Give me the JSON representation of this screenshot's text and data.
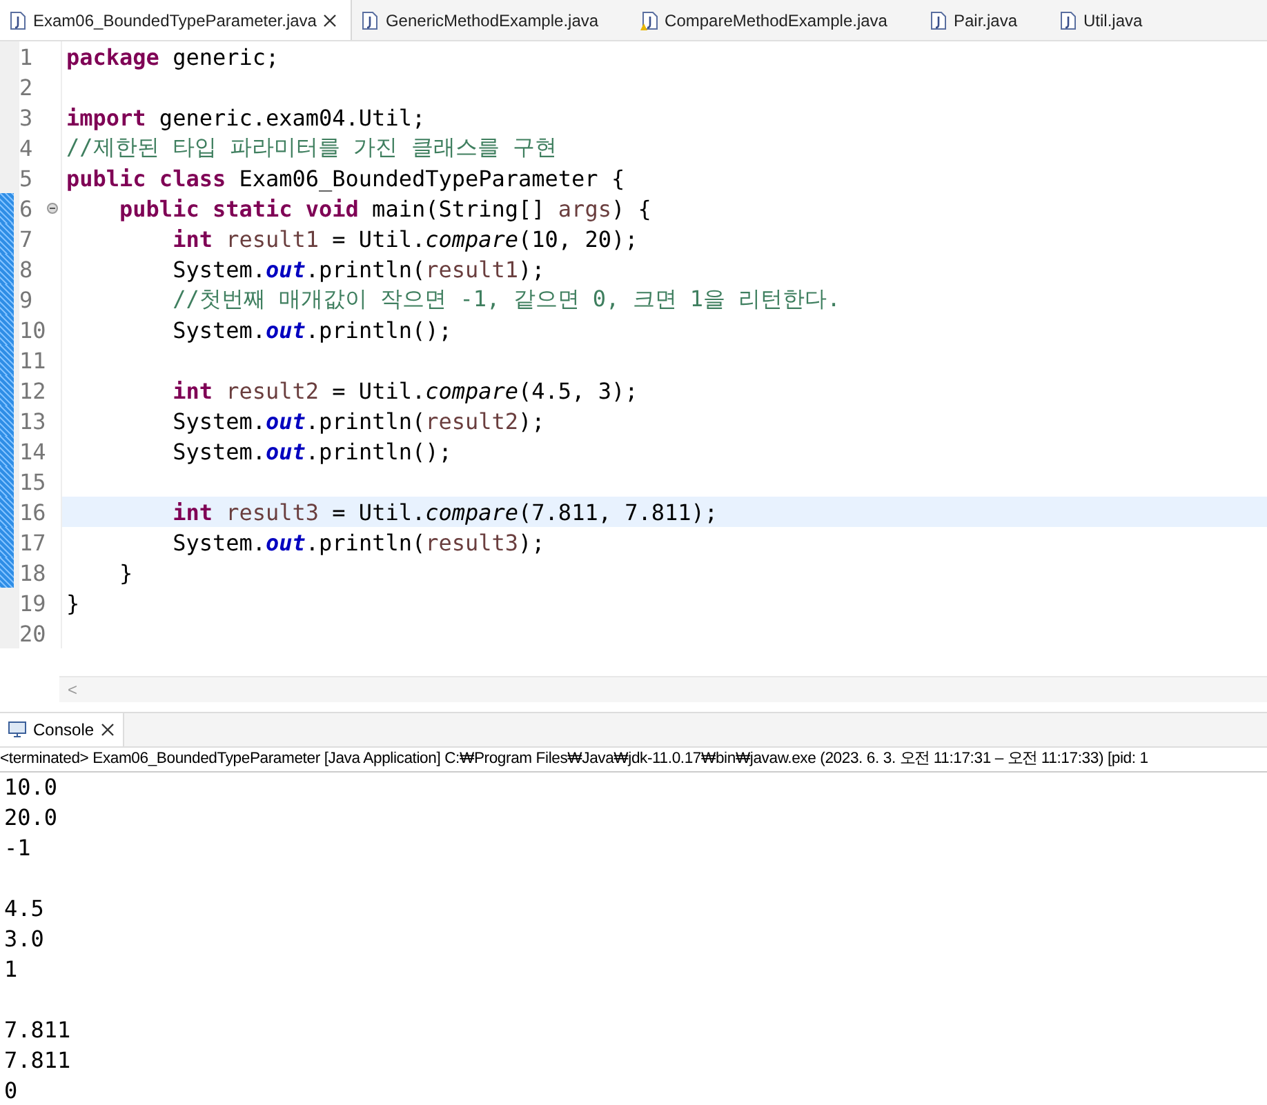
{
  "editor_tabs": [
    {
      "label": "Exam06_BoundedTypeParameter.java",
      "selected": true,
      "warning": false
    },
    {
      "label": "GenericMethodExample.java",
      "selected": false,
      "warning": false
    },
    {
      "label": "CompareMethodExample.java",
      "selected": false,
      "warning": true
    },
    {
      "label": "Pair.java",
      "selected": false,
      "warning": false
    },
    {
      "label": "Util.java",
      "selected": false,
      "warning": false
    }
  ],
  "code_lines": [
    {
      "number": "1",
      "changed": false,
      "current": false,
      "fold": false,
      "tokens": [
        {
          "kind": "keyword",
          "text": "package"
        },
        {
          "kind": "plain",
          "text": " generic;"
        }
      ]
    },
    {
      "number": "2",
      "changed": false,
      "current": false,
      "fold": false
    },
    {
      "number": "3",
      "changed": false,
      "current": false,
      "fold": false,
      "tokens": [
        {
          "kind": "keyword",
          "text": "import"
        },
        {
          "kind": "plain",
          "text": " generic.exam04.Util;"
        }
      ]
    },
    {
      "number": "4",
      "changed": false,
      "current": false,
      "fold": false,
      "tokens": [
        {
          "kind": "comment",
          "text": "//제한된 타입 파라미터를 가진 클래스를 구현"
        }
      ]
    },
    {
      "number": "5",
      "changed": false,
      "current": false,
      "fold": false,
      "tokens": [
        {
          "kind": "keyword",
          "text": "public class"
        },
        {
          "kind": "plain",
          "text": " Exam06_BoundedTypeParameter {"
        }
      ]
    },
    {
      "number": "6",
      "changed": true,
      "current": false,
      "fold": true,
      "tokens": [
        {
          "kind": "keyword",
          "text": "    public static void"
        },
        {
          "kind": "plain",
          "text": " main(String[] "
        },
        {
          "kind": "param",
          "text": "args"
        },
        {
          "kind": "plain",
          "text": ") {"
        }
      ]
    },
    {
      "number": "7",
      "changed": true,
      "current": false,
      "fold": false,
      "tokens": [
        {
          "kind": "keyword",
          "text": "        int"
        },
        {
          "kind": "local",
          "text": " result1"
        },
        {
          "kind": "plain",
          "text": " = Util."
        },
        {
          "kind": "method",
          "text": "compare"
        },
        {
          "kind": "plain",
          "text": "(10, 20);"
        }
      ]
    },
    {
      "number": "8",
      "changed": true,
      "current": false,
      "fold": false,
      "tokens": [
        {
          "kind": "plain",
          "text": "        System."
        },
        {
          "kind": "field",
          "text": "out"
        },
        {
          "kind": "plain",
          "text": ".println("
        },
        {
          "kind": "local",
          "text": "result1"
        },
        {
          "kind": "plain",
          "text": ");"
        }
      ]
    },
    {
      "number": "9",
      "changed": true,
      "current": false,
      "fold": false,
      "tokens": [
        {
          "kind": "comment",
          "text": "        //첫번째 매개값이 작으면 -1, 같으면 0, 크면 1을 리턴한다."
        }
      ]
    },
    {
      "number": "10",
      "changed": true,
      "current": false,
      "fold": false,
      "tokens": [
        {
          "kind": "plain",
          "text": "        System."
        },
        {
          "kind": "field",
          "text": "out"
        },
        {
          "kind": "plain",
          "text": ".println();"
        }
      ]
    },
    {
      "number": "11",
      "changed": true,
      "current": false,
      "fold": false
    },
    {
      "number": "12",
      "changed": true,
      "current": false,
      "fold": false,
      "tokens": [
        {
          "kind": "keyword",
          "text": "        int"
        },
        {
          "kind": "local",
          "text": " result2"
        },
        {
          "kind": "plain",
          "text": " = Util."
        },
        {
          "kind": "method",
          "text": "compare"
        },
        {
          "kind": "plain",
          "text": "(4.5, 3);"
        }
      ]
    },
    {
      "number": "13",
      "changed": true,
      "current": false,
      "fold": false,
      "tokens": [
        {
          "kind": "plain",
          "text": "        System."
        },
        {
          "kind": "field",
          "text": "out"
        },
        {
          "kind": "plain",
          "text": ".println("
        },
        {
          "kind": "local",
          "text": "result2"
        },
        {
          "kind": "plain",
          "text": ");"
        }
      ]
    },
    {
      "number": "14",
      "changed": true,
      "current": false,
      "fold": false,
      "tokens": [
        {
          "kind": "plain",
          "text": "        System."
        },
        {
          "kind": "field",
          "text": "out"
        },
        {
          "kind": "plain",
          "text": ".println();"
        }
      ]
    },
    {
      "number": "15",
      "changed": true,
      "current": false,
      "fold": false
    },
    {
      "number": "16",
      "changed": true,
      "current": true,
      "fold": false,
      "tokens": [
        {
          "kind": "keyword",
          "text": "        int"
        },
        {
          "kind": "local",
          "text": " result3"
        },
        {
          "kind": "plain",
          "text": " = Util."
        },
        {
          "kind": "method",
          "text": "compare"
        },
        {
          "kind": "plain",
          "text": "(7.811, 7.811);"
        }
      ]
    },
    {
      "number": "17",
      "changed": true,
      "current": false,
      "fold": false,
      "tokens": [
        {
          "kind": "plain",
          "text": "        System."
        },
        {
          "kind": "field",
          "text": "out"
        },
        {
          "kind": "plain",
          "text": ".println("
        },
        {
          "kind": "local",
          "text": "result3"
        },
        {
          "kind": "plain",
          "text": ");"
        }
      ]
    },
    {
      "number": "18",
      "changed": true,
      "current": false,
      "fold": false,
      "tokens": [
        {
          "kind": "plain",
          "text": "    }"
        }
      ]
    },
    {
      "number": "19",
      "changed": false,
      "current": false,
      "fold": false,
      "tokens": [
        {
          "kind": "plain",
          "text": "}"
        }
      ]
    },
    {
      "number": "20",
      "changed": false,
      "current": false,
      "fold": false
    }
  ],
  "scroll_arrow": "<",
  "console": {
    "tab": "Console",
    "status": "<terminated> Exam06_BoundedTypeParameter [Java Application] C:₩Program Files₩Java₩jdk-11.0.17₩bin₩javaw.exe  (2023. 6. 3. 오전 11:17:31 – 오전 11:17:33) [pid: 1",
    "output_blocks": [
      [
        "10.0",
        "20.0",
        "-1"
      ],
      [
        "4.5",
        "3.0",
        "1"
      ],
      [
        "7.811",
        "7.811",
        "0"
      ]
    ]
  }
}
